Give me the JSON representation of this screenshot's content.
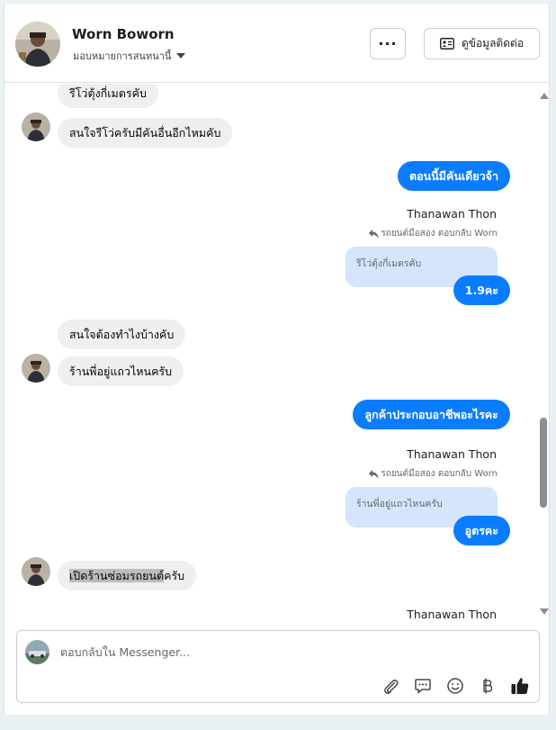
{
  "header": {
    "contact_name": "Worn Boworn",
    "assign_label": "มอบหมายการสนทนานี้",
    "more_label": "···",
    "contact_info_label": "ดูข้อมูลติดต่อ"
  },
  "messages": {
    "m1": "รีโว่ตุ้งกี่เมตรคับ",
    "m2": "สนใจรีโว่ครับมีคันอื่นอีกไหมคับ",
    "m3": "ตอนนี้มีคันเดียวจ้า",
    "m4_sender": "Thanawan Thon",
    "m4_reply_note": "รถยนต์มือสอง ตอบกลับ Worn",
    "m4_quote": "รีโว่ตุ้งกี่เมตรคับ",
    "m4_text": "1.9คะ",
    "m5": "สนใจต้องทำไงบ้างคับ",
    "m6": "ร้านพี่อยู่แถวไหนครับ",
    "m7": "ลูกค้าประกอบอาชีพอะไรคะ",
    "m8_sender": "Thanawan Thon",
    "m8_reply_note": "รถยนต์มือสอง ตอบกลับ Worn",
    "m8_quote": "ร้านพี่อยู่แถวไหนครับ",
    "m8_text": "อูตรคะ",
    "m9_highlight": "เปิดร้านซ่อมรถยนต",
    "m9_rest": "์ครับ",
    "m10_sender": "Thanawan Thon"
  },
  "composer": {
    "placeholder": "ตอบกลับใน Messenger..."
  },
  "colors": {
    "outgoing_bubble": "#0a7cff",
    "incoming_bubble": "#efefef",
    "quoted_bubble": "#d4e5fc"
  },
  "icons": [
    "contact-card-icon",
    "paperclip-icon",
    "saved-reply-icon",
    "emoji-icon",
    "baht-icon",
    "thumbs-up-icon",
    "reply-arrow-icon"
  ]
}
